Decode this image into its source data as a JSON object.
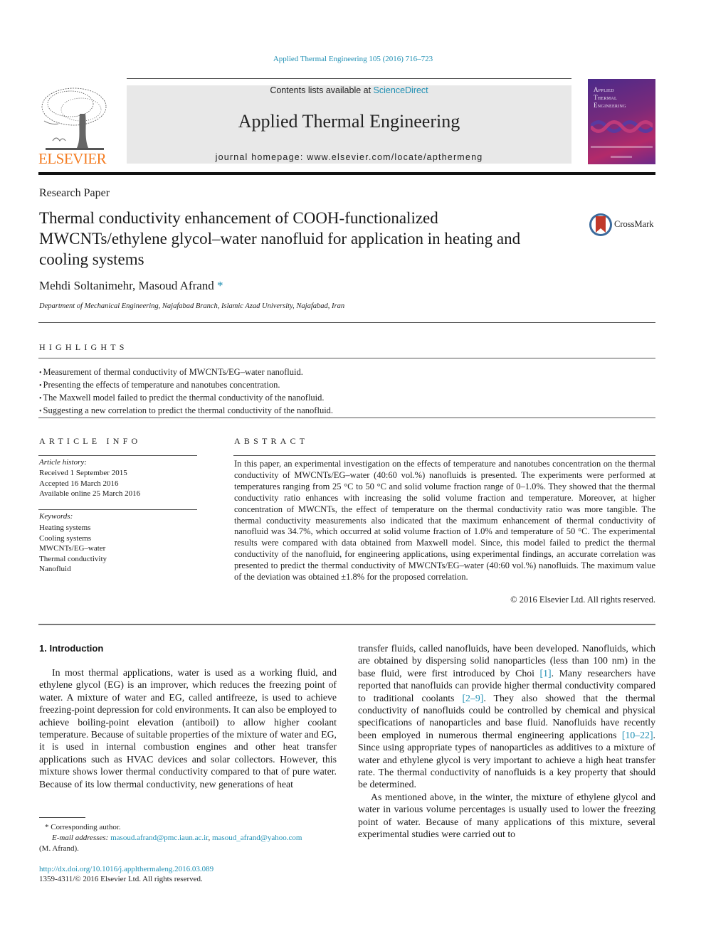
{
  "journal_ref": "Applied Thermal Engineering 105 (2016) 716–723",
  "masthead": {
    "contents_prefix": "Contents lists available at ",
    "contents_link": "ScienceDirect",
    "journal_name": "Applied Thermal Engineering",
    "homepage": "journal homepage: www.elsevier.com/locate/apthermeng"
  },
  "publisher": {
    "wordmark": "ELSEVIER",
    "logo_icon": "elsevier-tree-icon",
    "wordmark_color": "#f47b20"
  },
  "cover": {
    "title_lines": [
      "Applied",
      "Thermal",
      "Engineering"
    ]
  },
  "crossmark": {
    "label": "CrossMark",
    "icon": "crossmark-icon"
  },
  "article": {
    "type": "Research Paper",
    "title": "Thermal conductivity enhancement of COOH-functionalized MWCNTs/ethylene glycol–water nanofluid for application in heating and cooling systems",
    "authors": "Mehdi Soltanimehr, Masoud Afrand",
    "author_mark": "*",
    "affiliation": "Department of Mechanical Engineering, Najafabad Branch, Islamic Azad University, Najafabad, Iran"
  },
  "highlights": {
    "heading": "HIGHLIGHTS",
    "items": [
      "Measurement of thermal conductivity of MWCNTs/EG–water nanofluid.",
      "Presenting the effects of temperature and nanotubes concentration.",
      "The Maxwell model failed to predict the thermal conductivity of the nanofluid.",
      "Suggesting a new correlation to predict the thermal conductivity of the nanofluid."
    ]
  },
  "article_info": {
    "heading": "ARTICLE INFO",
    "history_label": "Article history:",
    "history": [
      "Received 1 September 2015",
      "Accepted 16 March 2016",
      "Available online 25 March 2016"
    ],
    "keywords_label": "Keywords:",
    "keywords": [
      "Heating systems",
      "Cooling systems",
      "MWCNTs/EG–water",
      "Thermal conductivity",
      "Nanofluid"
    ]
  },
  "abstract": {
    "heading": "ABSTRACT",
    "text": "In this paper, an experimental investigation on the effects of temperature and nanotubes concentration on the thermal conductivity of MWCNTs/EG–water (40:60 vol.%) nanofluids is presented. The experiments were performed at temperatures ranging from 25 °C to 50 °C and solid volume fraction range of 0–1.0%. They showed that the thermal conductivity ratio enhances with increasing the solid volume fraction and temperature. Moreover, at higher concentration of MWCNTs, the effect of temperature on the thermal conductivity ratio was more tangible. The thermal conductivity measurements also indicated that the maximum enhancement of thermal conductivity of nanofluid was 34.7%, which occurred at solid volume fraction of 1.0% and temperature of 50 °C. The experimental results were compared with data obtained from Maxwell model. Since, this model failed to predict the thermal conductivity of the nanofluid, for engineering applications, using experimental findings, an accurate correlation was presented to predict the thermal conductivity of MWCNTs/EG–water (40:60 vol.%) nanofluids. The maximum value of the deviation was obtained ±1.8% for the proposed correlation.",
    "copyright": "© 2016 Elsevier Ltd. All rights reserved."
  },
  "introduction": {
    "heading": "1. Introduction",
    "left_paragraph": "In most thermal applications, water is used as a working fluid, and ethylene glycol (EG) is an improver, which reduces the freezing point of water. A mixture of water and EG, called antifreeze, is used to achieve freezing-point depression for cold environments. It can also be employed to achieve boiling-point elevation (antiboil) to allow higher coolant temperature. Because of suitable properties of the mixture of water and EG, it is used in internal combustion engines and other heat transfer applications such as HVAC devices and solar collectors. However, this mixture shows lower thermal conductivity compared to that of pure water. Because of its low thermal conductivity, new generations of heat",
    "right_p1": {
      "t1": "transfer fluids, called nanofluids, have been developed. Nanofluids, which are obtained by dispersing solid nanoparticles (less than 100 nm) in the base fluid, were first introduced by Choi ",
      "ref1": "[1]",
      "t2": ". Many researchers have reported that nanofluids can provide higher thermal conductivity compared to traditional coolants ",
      "ref2": "[2–9]",
      "t3": ". They also showed that the thermal conductivity of nanofluids could be controlled by chemical and physical specifications of nanoparticles and base fluid. Nanofluids have recently been employed in numerous thermal engineering applications ",
      "ref3": "[10–22]",
      "t4": ". Since using appropriate types of nanoparticles as additives to a mixture of water and ethylene glycol is very important to achieve a high heat transfer rate. The thermal conductivity of nanofluids is a key property that should be determined."
    },
    "right_p2": "As mentioned above, in the winter, the mixture of ethylene glycol and water in various volume percentages is usually used to lower the freezing point of water. Because of many applications of this mixture, several experimental studies were carried out to"
  },
  "footnote": {
    "corresponding": "* Corresponding author.",
    "email_label": "E-mail addresses:",
    "email1": "masoud.afrand@pmc.iaun.ac.ir",
    "email2": "masoud_afrand@yahoo.com",
    "email_owner": "(M. Afrand).",
    "doi": "http://dx.doi.org/10.1016/j.applthermaleng.2016.03.089",
    "issn": "1359-4311/© 2016 Elsevier Ltd. All rights reserved."
  }
}
